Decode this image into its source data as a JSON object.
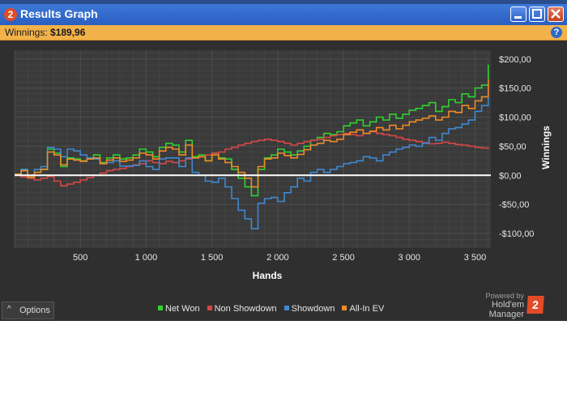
{
  "window": {
    "title": "Results Graph"
  },
  "infobar": {
    "label": "Winnings:",
    "value": "$189,96",
    "help_glyph": "?"
  },
  "footer": {
    "options_label": "Options",
    "powered_by": "Powered by",
    "brand": "Hold'em Manager",
    "brand_glyph": "2"
  },
  "colors": {
    "net_won": "#2fd22f",
    "non_showdown": "#d84646",
    "showdown": "#3f88d2",
    "all_in_ev": "#ee8a28",
    "plot_bg": "#3a3a3a",
    "grid": "#4d4d4d",
    "zero_line": "#ffffff"
  },
  "chart_data": {
    "type": "line",
    "title": "",
    "xlabel": "Hands",
    "ylabel": "Winnings",
    "xlim": [
      0,
      3620
    ],
    "ylim": [
      -125,
      215
    ],
    "x_ticks": [
      500,
      1000,
      1500,
      2000,
      2500,
      3000,
      3500
    ],
    "x_tick_labels": [
      "500",
      "1 000",
      "1 500",
      "2 000",
      "2 500",
      "3 000",
      "3 500"
    ],
    "y_ticks": [
      200,
      150,
      100,
      50,
      0,
      -50,
      -100
    ],
    "y_tick_labels": [
      "$200,00",
      "$150,00",
      "$100,00",
      "$50,00",
      "$0,00",
      "-$50,00",
      "-$100,00"
    ],
    "grid": true,
    "legend_position": "bottom",
    "series": [
      {
        "name": "Net Won",
        "color": "#2fd22f",
        "x": [
          0,
          50,
          100,
          150,
          200,
          250,
          300,
          350,
          400,
          450,
          500,
          550,
          600,
          650,
          700,
          750,
          800,
          850,
          900,
          950,
          1000,
          1050,
          1100,
          1150,
          1200,
          1250,
          1300,
          1350,
          1400,
          1450,
          1500,
          1550,
          1600,
          1650,
          1700,
          1750,
          1800,
          1850,
          1900,
          1950,
          2000,
          2050,
          2100,
          2150,
          2200,
          2250,
          2300,
          2350,
          2400,
          2450,
          2500,
          2550,
          2600,
          2650,
          2700,
          2750,
          2800,
          2850,
          2900,
          2950,
          3000,
          3050,
          3100,
          3150,
          3200,
          3250,
          3300,
          3350,
          3400,
          3450,
          3500,
          3550,
          3600
        ],
        "y": [
          2,
          10,
          -5,
          5,
          10,
          45,
          38,
          15,
          30,
          28,
          25,
          30,
          35,
          22,
          30,
          35,
          28,
          30,
          35,
          45,
          40,
          32,
          48,
          55,
          52,
          40,
          60,
          32,
          35,
          25,
          38,
          30,
          28,
          10,
          -5,
          -20,
          -35,
          10,
          30,
          35,
          45,
          40,
          35,
          42,
          50,
          60,
          65,
          72,
          70,
          75,
          85,
          90,
          95,
          85,
          92,
          100,
          95,
          105,
          98,
          105,
          112,
          115,
          120,
          125,
          110,
          118,
          130,
          125,
          140,
          135,
          150,
          155,
          190
        ]
      },
      {
        "name": "Non Showdown",
        "color": "#d84646",
        "x": [
          0,
          50,
          100,
          150,
          200,
          250,
          300,
          350,
          400,
          450,
          500,
          550,
          600,
          650,
          700,
          750,
          800,
          850,
          900,
          950,
          1000,
          1050,
          1100,
          1150,
          1200,
          1250,
          1300,
          1350,
          1400,
          1450,
          1500,
          1550,
          1600,
          1650,
          1700,
          1750,
          1800,
          1850,
          1900,
          1950,
          2000,
          2050,
          2100,
          2150,
          2200,
          2250,
          2300,
          2350,
          2400,
          2450,
          2500,
          2550,
          2600,
          2650,
          2700,
          2750,
          2800,
          2850,
          2900,
          2950,
          3000,
          3050,
          3100,
          3150,
          3200,
          3250,
          3300,
          3350,
          3400,
          3450,
          3500,
          3550,
          3600
        ],
        "y": [
          0,
          -3,
          -5,
          -8,
          -5,
          -2,
          -10,
          -18,
          -15,
          -12,
          -8,
          -4,
          0,
          4,
          8,
          10,
          12,
          15,
          18,
          20,
          25,
          22,
          20,
          24,
          22,
          25,
          28,
          30,
          32,
          35,
          38,
          40,
          45,
          48,
          52,
          55,
          58,
          60,
          62,
          60,
          58,
          55,
          52,
          55,
          58,
          60,
          62,
          65,
          68,
          70,
          72,
          70,
          68,
          72,
          75,
          72,
          70,
          68,
          65,
          62,
          60,
          58,
          56,
          54,
          55,
          57,
          55,
          53,
          52,
          50,
          48,
          47,
          45
        ]
      },
      {
        "name": "Showdown",
        "color": "#3f88d2",
        "x": [
          0,
          50,
          100,
          150,
          200,
          250,
          300,
          350,
          400,
          450,
          500,
          550,
          600,
          650,
          700,
          750,
          800,
          850,
          900,
          950,
          1000,
          1050,
          1100,
          1150,
          1200,
          1250,
          1300,
          1350,
          1400,
          1450,
          1500,
          1550,
          1600,
          1650,
          1700,
          1750,
          1800,
          1850,
          1900,
          1950,
          2000,
          2050,
          2100,
          2150,
          2200,
          2250,
          2300,
          2350,
          2400,
          2450,
          2500,
          2550,
          2600,
          2650,
          2700,
          2750,
          2800,
          2850,
          2900,
          2950,
          3000,
          3050,
          3100,
          3150,
          3200,
          3250,
          3300,
          3350,
          3400,
          3450,
          3500,
          3550,
          3600
        ],
        "y": [
          2,
          10,
          0,
          10,
          15,
          48,
          45,
          32,
          45,
          42,
          35,
          30,
          28,
          20,
          22,
          25,
          16,
          16,
          17,
          25,
          15,
          10,
          28,
          30,
          30,
          15,
          30,
          5,
          0,
          -10,
          -12,
          -5,
          -20,
          -40,
          -60,
          -75,
          -92,
          -48,
          -40,
          -38,
          -45,
          -30,
          -20,
          -5,
          -10,
          5,
          10,
          5,
          10,
          15,
          20,
          22,
          25,
          32,
          30,
          25,
          35,
          40,
          45,
          48,
          52,
          50,
          55,
          65,
          60,
          72,
          80,
          82,
          88,
          95,
          110,
          120,
          145
        ]
      },
      {
        "name": "All-In EV",
        "color": "#ee8a28",
        "x": [
          0,
          50,
          100,
          150,
          200,
          250,
          300,
          350,
          400,
          450,
          500,
          550,
          600,
          650,
          700,
          750,
          800,
          850,
          900,
          950,
          1000,
          1050,
          1100,
          1150,
          1200,
          1250,
          1300,
          1350,
          1400,
          1450,
          1500,
          1550,
          1600,
          1650,
          1700,
          1750,
          1800,
          1850,
          1900,
          1950,
          2000,
          2050,
          2100,
          2150,
          2200,
          2250,
          2300,
          2350,
          2400,
          2450,
          2500,
          2550,
          2600,
          2650,
          2700,
          2750,
          2800,
          2850,
          2900,
          2950,
          3000,
          3050,
          3100,
          3150,
          3200,
          3250,
          3300,
          3350,
          3400,
          3450,
          3500,
          3550,
          3600
        ],
        "y": [
          2,
          8,
          -3,
          5,
          10,
          40,
          35,
          18,
          28,
          26,
          24,
          28,
          30,
          20,
          26,
          30,
          24,
          26,
          30,
          38,
          35,
          28,
          42,
          48,
          45,
          35,
          52,
          30,
          32,
          25,
          35,
          28,
          22,
          15,
          5,
          -5,
          -20,
          15,
          28,
          30,
          38,
          34,
          30,
          36,
          44,
          52,
          55,
          60,
          58,
          62,
          70,
          74,
          78,
          72,
          76,
          82,
          78,
          86,
          80,
          86,
          92,
          95,
          98,
          102,
          95,
          100,
          110,
          108,
          120,
          115,
          128,
          135,
          165
        ]
      }
    ]
  }
}
